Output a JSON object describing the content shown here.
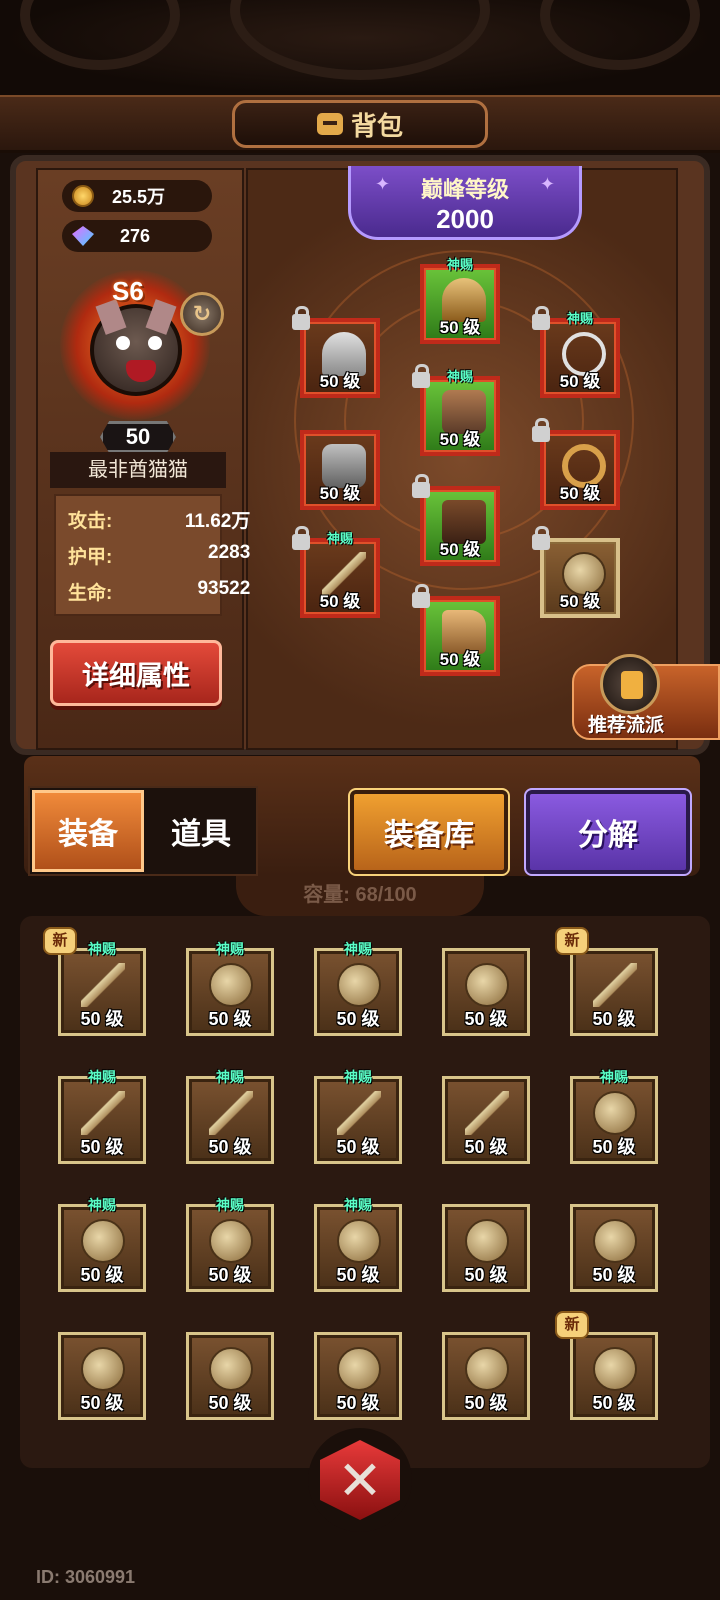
{
  "header": {
    "title": "背包",
    "icon": "bag-icon"
  },
  "currency": {
    "gold": "25.5万",
    "gems": "276"
  },
  "hero": {
    "rank": "S6",
    "level": "50",
    "name": "最非酋猫猫",
    "stats": [
      {
        "label": "攻击:",
        "value": "11.62万"
      },
      {
        "label": "护甲:",
        "value": "2283"
      },
      {
        "label": "生命:",
        "value": "93522"
      }
    ],
    "detail_button": "详细属性"
  },
  "peak": {
    "label": "巅峰等级",
    "value": "2000"
  },
  "equip_slots": [
    {
      "id": "helm-left",
      "level": "50 级",
      "tag": "",
      "locked": true,
      "style": "red",
      "item": "helm"
    },
    {
      "id": "helm-top",
      "level": "50 级",
      "tag": "神赐",
      "locked": false,
      "style": "green",
      "item": "helm-gold"
    },
    {
      "id": "necklace",
      "level": "50 级",
      "tag": "神赐",
      "locked": true,
      "style": "red",
      "item": "necklace"
    },
    {
      "id": "armor",
      "level": "50 级",
      "tag": "神赐",
      "locked": true,
      "style": "green",
      "item": "armor"
    },
    {
      "id": "glove",
      "level": "50 级",
      "tag": "",
      "locked": false,
      "style": "red",
      "item": "glove"
    },
    {
      "id": "ring",
      "level": "50 级",
      "tag": "",
      "locked": true,
      "style": "red",
      "item": "ring-item"
    },
    {
      "id": "pants",
      "level": "50 级",
      "tag": "",
      "locked": true,
      "style": "green",
      "item": "pants"
    },
    {
      "id": "weapon",
      "level": "50 级",
      "tag": "神赐",
      "locked": true,
      "style": "red",
      "item": "sword"
    },
    {
      "id": "offhand",
      "level": "50 级",
      "tag": "",
      "locked": true,
      "style": "gold",
      "item": "shield"
    },
    {
      "id": "boots",
      "level": "50 级",
      "tag": "",
      "locked": true,
      "style": "green",
      "item": "boots"
    }
  ],
  "recommend": {
    "label": "推荐流派"
  },
  "tabs": {
    "equip": "装备",
    "props": "道具",
    "library": "装备库",
    "dismantle": "分解"
  },
  "capacity": "容量: 68/100",
  "inventory": [
    {
      "level": "50 级",
      "tag": "神赐",
      "new": "新",
      "item": "sword"
    },
    {
      "level": "50 级",
      "tag": "神赐",
      "new": "",
      "item": "shield"
    },
    {
      "level": "50 级",
      "tag": "神赐",
      "new": "",
      "item": "shield"
    },
    {
      "level": "50 级",
      "tag": "",
      "new": "",
      "item": "shield"
    },
    {
      "level": "50 级",
      "tag": "",
      "new": "新",
      "item": "sword"
    },
    {
      "level": "50 级",
      "tag": "神赐",
      "new": "",
      "item": "sword"
    },
    {
      "level": "50 级",
      "tag": "神赐",
      "new": "",
      "item": "sword"
    },
    {
      "level": "50 级",
      "tag": "神赐",
      "new": "",
      "item": "sword"
    },
    {
      "level": "50 级",
      "tag": "",
      "new": "",
      "item": "sword"
    },
    {
      "level": "50 级",
      "tag": "神赐",
      "new": "",
      "item": "shield"
    },
    {
      "level": "50 级",
      "tag": "神赐",
      "new": "",
      "item": "shield"
    },
    {
      "level": "50 级",
      "tag": "神赐",
      "new": "",
      "item": "shield"
    },
    {
      "level": "50 级",
      "tag": "神赐",
      "new": "",
      "item": "shield"
    },
    {
      "level": "50 级",
      "tag": "",
      "new": "",
      "item": "shield"
    },
    {
      "level": "50 级",
      "tag": "",
      "new": "",
      "item": "shield"
    },
    {
      "level": "50 级",
      "tag": "",
      "new": "",
      "item": "shield"
    },
    {
      "level": "50 级",
      "tag": "",
      "new": "",
      "item": "shield"
    },
    {
      "level": "50 级",
      "tag": "",
      "new": "",
      "item": "shield"
    },
    {
      "level": "50 级",
      "tag": "",
      "new": "",
      "item": "shield"
    },
    {
      "level": "50 级",
      "tag": "",
      "new": "新",
      "item": "shield"
    }
  ],
  "footer": {
    "player_id": "ID: 3060991"
  }
}
